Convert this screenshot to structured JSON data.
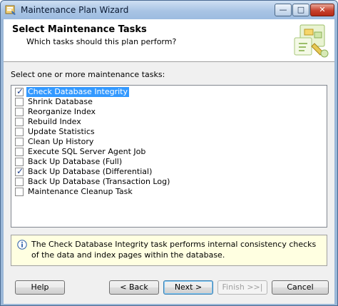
{
  "window": {
    "title": "Maintenance Plan Wizard",
    "controls": {
      "minimize": "—",
      "maximize": "□",
      "close": "✕"
    }
  },
  "header": {
    "title": "Select Maintenance Tasks",
    "subtitle": "Which tasks should this plan perform?"
  },
  "tasks": {
    "prompt": "Select one or more maintenance tasks:",
    "items": [
      {
        "label": "Check Database Integrity",
        "checked": true,
        "selected": true
      },
      {
        "label": "Shrink Database",
        "checked": false,
        "selected": false
      },
      {
        "label": "Reorganize Index",
        "checked": false,
        "selected": false
      },
      {
        "label": "Rebuild Index",
        "checked": false,
        "selected": false
      },
      {
        "label": "Update Statistics",
        "checked": false,
        "selected": false
      },
      {
        "label": "Clean Up History",
        "checked": false,
        "selected": false
      },
      {
        "label": "Execute SQL Server Agent Job",
        "checked": false,
        "selected": false
      },
      {
        "label": "Back Up Database (Full)",
        "checked": false,
        "selected": false
      },
      {
        "label": "Back Up Database (Differential)",
        "checked": true,
        "selected": false
      },
      {
        "label": "Back Up Database (Transaction Log)",
        "checked": false,
        "selected": false
      },
      {
        "label": "Maintenance Cleanup Task",
        "checked": false,
        "selected": false
      }
    ]
  },
  "info": {
    "text": "The Check Database Integrity task performs internal consistency checks of the data and index pages within the database."
  },
  "buttons": {
    "help": "Help",
    "back": "< Back",
    "next": "Next >",
    "finish": "Finish >>|",
    "cancel": "Cancel"
  },
  "colors": {
    "selection": "#3399ff",
    "info_background": "#ffffe1",
    "titlebar": "#a9c4e4"
  },
  "icons": {
    "app": "wizard-app-icon",
    "info": "info-icon",
    "header": "maintenance-graphic-icon"
  }
}
